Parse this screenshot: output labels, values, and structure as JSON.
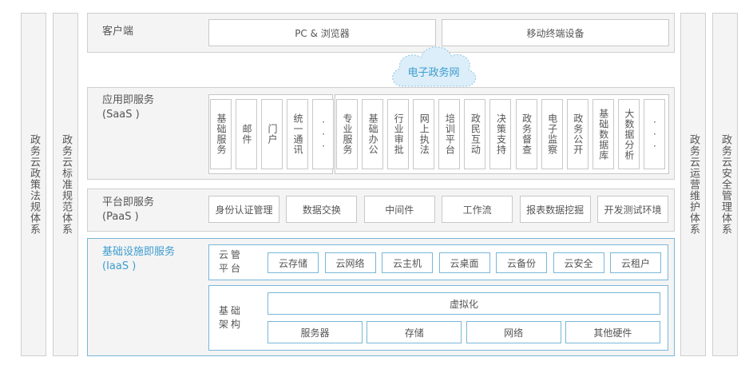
{
  "left_pillars": [
    "政务云政策法规体系",
    "政务云标准规范体系"
  ],
  "right_pillars": [
    "政务云运营维护体系",
    "政务云安全管理体系"
  ],
  "client": {
    "title": "客户端",
    "items": [
      "PC & 浏览器",
      "移动终端设备"
    ]
  },
  "egov_network": "电子政务网",
  "saas": {
    "title": "应用即服务",
    "subtitle": "(SaaS )",
    "group1": [
      "基础服务",
      "邮件",
      "门户",
      "统一通讯",
      "···"
    ],
    "group2": [
      "专业服务",
      "基础办公",
      "行业审批",
      "网上执法",
      "培训平台",
      "政民互动",
      "决策支持",
      "政务督查",
      "电子监察",
      "政务公开",
      "基础数据库",
      "大数据分析",
      "···"
    ]
  },
  "paas": {
    "title": "平台即服务",
    "subtitle": "(PaaS )",
    "items": [
      "身份认证管理",
      "数据交换",
      "中间件",
      "工作流",
      "报表数据挖掘",
      "开发测试环境"
    ]
  },
  "iaas": {
    "title": "基础设施即服务",
    "subtitle": "(IaaS )",
    "cloud_mgmt_label": "云管平台",
    "cloud_mgmt_items": [
      "云存储",
      "云网络",
      "云主机",
      "云桌面",
      "云备份",
      "云安全",
      "云租户"
    ],
    "infra_label": "基础架构",
    "virtualization": "虚拟化",
    "hardware": [
      "服务器",
      "存储",
      "网络",
      "其他硬件"
    ]
  },
  "colors": {
    "accent": "#3d9ccf",
    "border": "#cfcfcf",
    "panel": "#f4f4f4",
    "cloud_fill": "#dceef9"
  }
}
